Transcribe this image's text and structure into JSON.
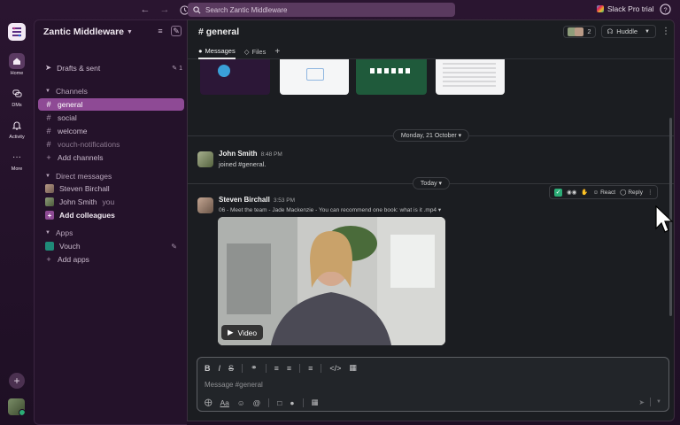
{
  "topbar": {
    "search_placeholder": "Search Zantic Middleware",
    "trial_label": "Slack Pro trial"
  },
  "rail": {
    "items": [
      {
        "label": "Home",
        "icon": "home-icon"
      },
      {
        "label": "DMs",
        "icon": "dms-icon"
      },
      {
        "label": "Activity",
        "icon": "bell-icon"
      },
      {
        "label": "More",
        "icon": "ellipsis-icon"
      }
    ]
  },
  "sidebar": {
    "workspace": "Zantic Middleware",
    "drafts": {
      "label": "Drafts & sent",
      "count": "1"
    },
    "channels_header": "Channels",
    "channels": [
      {
        "name": "general",
        "active": true
      },
      {
        "name": "social"
      },
      {
        "name": "welcome"
      },
      {
        "name": "vouch-notifications",
        "muted": true
      }
    ],
    "add_channels": "Add channels",
    "dm_header": "Direct messages",
    "dms": [
      {
        "name": "Steven Birchall"
      },
      {
        "name": "John Smith",
        "suffix": "you"
      }
    ],
    "add_colleagues": "Add colleagues",
    "apps_header": "Apps",
    "apps": [
      {
        "name": "Vouch"
      }
    ],
    "add_apps": "Add apps"
  },
  "channel": {
    "title": "# general",
    "member_count": "2",
    "huddle_label": "Huddle",
    "tabs": [
      {
        "label": "Messages",
        "active": true
      },
      {
        "label": "Files"
      }
    ]
  },
  "messages": {
    "date_pill": "Monday, 21 October",
    "today_pill": "Today",
    "m1": {
      "author": "John Smith",
      "time": "8:48 PM",
      "text": "joined #general."
    },
    "m2": {
      "author": "Steven Birchall",
      "time": "3:53 PM",
      "file_title": "06 - Meet the team - Jade Mackenzie - You can recommend one book: what is it .mp4"
    },
    "video_label": "Video",
    "hover_actions": {
      "react": "React",
      "reply": "Reply"
    }
  },
  "composer": {
    "placeholder": "Message #general"
  },
  "colors": {
    "active_channel": "#8e4a95",
    "sidebar_bg": "#24122a",
    "main_bg": "#1b1d21",
    "online": "#2bac76"
  }
}
